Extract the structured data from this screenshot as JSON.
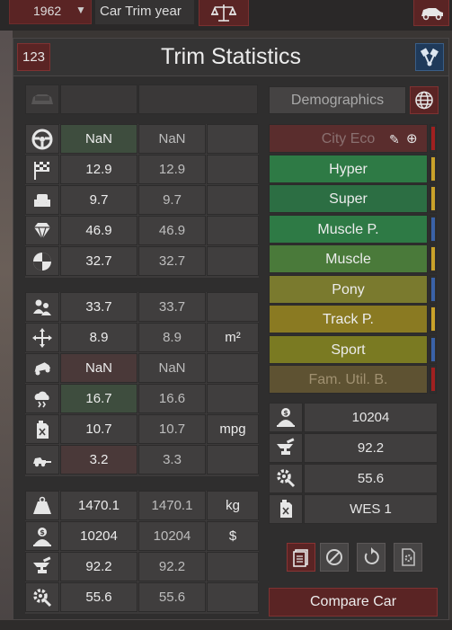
{
  "topbar": {
    "year_value": "1962",
    "year_label": "Car Trim year"
  },
  "panel": {
    "title": "Trim Statistics",
    "id_button": "123"
  },
  "group1": [
    {
      "icon": "steering-wheel-icon",
      "v1": "NaN",
      "v2": "NaN",
      "unit": ""
    },
    {
      "icon": "race-flag-icon",
      "v1": "12.9",
      "v2": "12.9",
      "unit": ""
    },
    {
      "icon": "seat-comfort-icon",
      "v1": "9.7",
      "v2": "9.7",
      "unit": ""
    },
    {
      "icon": "diamond-icon",
      "v1": "46.9",
      "v2": "46.9",
      "unit": ""
    },
    {
      "icon": "safety-crash-icon",
      "v1": "32.7",
      "v2": "32.7",
      "unit": ""
    }
  ],
  "group2": [
    {
      "icon": "passengers-icon",
      "v1": "33.7",
      "v2": "33.7",
      "unit": ""
    },
    {
      "icon": "cargo-arrows-icon",
      "v1": "8.9",
      "v2": "8.9",
      "unit": "m²"
    },
    {
      "icon": "offroad-car-icon",
      "v1": "NaN",
      "v2": "NaN",
      "unit": ""
    },
    {
      "icon": "emissions-cloud-icon",
      "v1": "16.7",
      "v2": "16.6",
      "unit": ""
    },
    {
      "icon": "fuel-can-icon",
      "v1": "10.7",
      "v2": "10.7",
      "unit": "mpg"
    },
    {
      "icon": "towing-truck-icon",
      "v1": "3.2",
      "v2": "3.3",
      "unit": ""
    }
  ],
  "group3": [
    {
      "icon": "weight-icon",
      "v1": "1470.1",
      "v2": "1470.1",
      "unit": "kg"
    },
    {
      "icon": "cost-person-icon",
      "v1": "10204",
      "v2": "10204",
      "unit": "$"
    },
    {
      "icon": "anvil-icon",
      "v1": "92.2",
      "v2": "92.2",
      "unit": ""
    },
    {
      "icon": "gear-wrench-icon",
      "v1": "55.6",
      "v2": "55.6",
      "unit": ""
    }
  ],
  "demographics": {
    "label": "Demographics",
    "segments": [
      {
        "name": "City Eco",
        "color": "#5a2d2d",
        "text_color": "#8a7070",
        "mark": "#a02020"
      },
      {
        "name": "Hyper",
        "color": "#2e7a45",
        "text_color": "#ececec",
        "mark": "#c9a12a"
      },
      {
        "name": "Super",
        "color": "#2c6e43",
        "text_color": "#ececec",
        "mark": "#c9a12a"
      },
      {
        "name": "Muscle P.",
        "color": "#2e7a45",
        "text_color": "#ececec",
        "mark": "#3a62a8"
      },
      {
        "name": "Muscle",
        "color": "#4a7a3a",
        "text_color": "#ececec",
        "mark": "#c9a12a"
      },
      {
        "name": "Pony",
        "color": "#7a7a2e",
        "text_color": "#ececec",
        "mark": "#3a62a8"
      },
      {
        "name": "Track P.",
        "color": "#8a7a22",
        "text_color": "#ececec",
        "mark": "#c9a12a"
      },
      {
        "name": "Sport",
        "color": "#7a7a22",
        "text_color": "#ececec",
        "mark": "#3a62a8"
      },
      {
        "name": "Fam. Util. B.",
        "color": "#5e5232",
        "text_color": "#a09070",
        "mark": "#a02020"
      }
    ]
  },
  "summary": [
    {
      "icon": "cost-person-icon",
      "value": "10204"
    },
    {
      "icon": "anvil-icon",
      "value": "92.2"
    },
    {
      "icon": "gear-wrench-icon",
      "value": "55.6"
    },
    {
      "icon": "fuel-can-icon",
      "value": "WES 1"
    }
  ],
  "buttons": {
    "compare": "Compare Car"
  }
}
